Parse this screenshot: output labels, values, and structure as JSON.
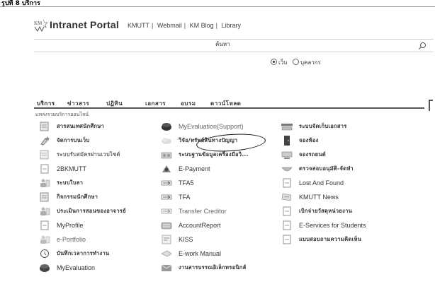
{
  "window": {
    "title": "รูปที่ 8 บริการ"
  },
  "header": {
    "portal_title": "Intranet Portal",
    "links": [
      "KMUTT",
      "Webmail",
      "KM Blog",
      "Library"
    ]
  },
  "search": {
    "label": "ค้นหา",
    "options": [
      {
        "label": "เว็บ",
        "selected": true
      },
      {
        "label": "บุคลากร",
        "selected": false
      }
    ]
  },
  "tabs": [
    {
      "label": "บริการ",
      "active": true
    },
    {
      "label": "ข่าวสาร",
      "active": false
    },
    {
      "label": "ปฏิทิน",
      "active": false
    },
    {
      "label": "เอกสาร",
      "active": false
    },
    {
      "label": "อบรม",
      "active": false
    },
    {
      "label": "ดาวน์โหลด",
      "active": false
    }
  ],
  "subcaption": "แหล่งรวมบริการออนไลน์",
  "services": {
    "col1": [
      {
        "label": "สารสนเทศนักศึกษา",
        "icon": "document-icon"
      },
      {
        "label": "จัดการบนเว็บ",
        "icon": "star-edit-icon"
      },
      {
        "label": "ระบบรับสมัครผ่านเวบไซต์",
        "icon": "document-icon",
        "muted": true
      },
      {
        "label": "2BKMUTT",
        "icon": "page-icon"
      },
      {
        "label": "ระบบใบลา",
        "icon": "people-icon"
      },
      {
        "label": "กิจกรรมนักศึกษา",
        "icon": "document-icon"
      },
      {
        "label": "ประเมินการสอนของอาจารย์",
        "icon": "people-icon"
      },
      {
        "label": "MyProfile",
        "icon": "page-icon"
      },
      {
        "label": "e-Portfolio",
        "icon": "people-icon",
        "muted": true
      },
      {
        "label": "บันทึกเวลาการทำงาน",
        "icon": "clock-icon"
      },
      {
        "label": "MyEvaluation",
        "icon": "globe-icon"
      }
    ],
    "col2": [
      {
        "label": "MyEvaluation(Support)",
        "icon": "globe-icon",
        "muted": true
      },
      {
        "label": "วิจัย/ทรัพย์สินทางปัญญา",
        "icon": "cloud-icon"
      },
      {
        "label": "ระบบฐานข้อมูลเครื่องมือวิ...",
        "icon": "instrument-icon"
      },
      {
        "label": "E-Payment",
        "icon": "payment-icon"
      },
      {
        "label": "TFA5",
        "icon": "transfer-icon"
      },
      {
        "label": "TFA",
        "icon": "transfer-icon"
      },
      {
        "label": "Transfer Creditor",
        "icon": "transfer-icon",
        "muted": true
      },
      {
        "label": "AccountReport",
        "icon": "report-icon"
      },
      {
        "label": "KISS",
        "icon": "kiss-icon"
      },
      {
        "label": "E-work Manual",
        "icon": "manual-icon"
      },
      {
        "label": "งานสารบรรณอิเล็กทรอนิกส์",
        "icon": "mail-icon"
      }
    ],
    "col3": [
      {
        "label": "ระบบจัดเก็บเอกสาร",
        "icon": "scanner-icon"
      },
      {
        "label": "จองห้อง",
        "icon": "door-icon"
      },
      {
        "label": "จองรถยนต์",
        "icon": "car-icon"
      },
      {
        "label": "ตรวจสอบอนุมัติ-จัดทำ",
        "icon": "bowl-icon"
      },
      {
        "label": "Lost And Found",
        "icon": "page-icon"
      },
      {
        "label": "KMUTT News",
        "icon": "news-icon"
      },
      {
        "label": "เบิกจ่ายวัสดุหน่วยงาน",
        "icon": "page-icon"
      },
      {
        "label": "E-Services for Students",
        "icon": "page-icon"
      },
      {
        "label": "แบบสอบถามความคิดเห็น",
        "icon": "page-icon"
      }
    ]
  },
  "highlighted_service": "วิจัย/ทรัพย์สินทางปัญญา"
}
